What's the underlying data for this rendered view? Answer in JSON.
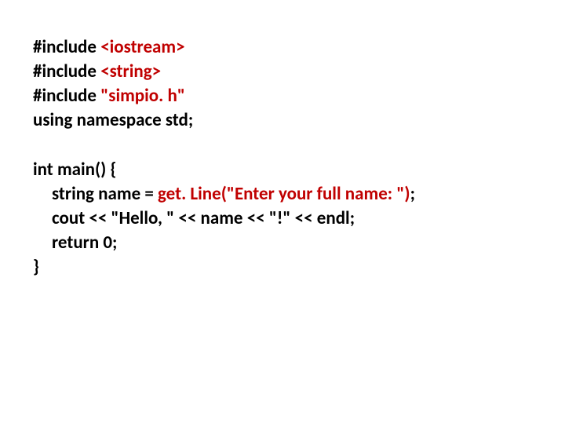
{
  "code": {
    "line1_a": "#include ",
    "line1_b": "<iostream>",
    "line2_a": "#include ",
    "line2_b": "<string>",
    "line3_a": "#include ",
    "line3_b": "\"simpio. h\"",
    "line4": "using namespace std;",
    "line5": "int main() {",
    "line6_a": "string name = ",
    "line6_b": "get. Line(\"Enter your full name: \")",
    "line6_c": ";",
    "line7": "cout << \"Hello, \" << name << \"!\" << endl;",
    "line8": "return 0;",
    "line9": "}"
  }
}
